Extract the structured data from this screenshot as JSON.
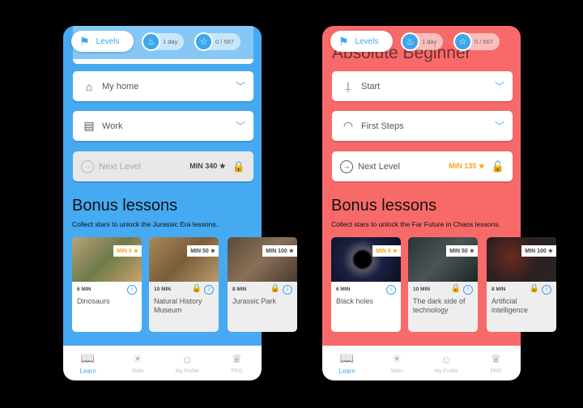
{
  "colors": {
    "accent": "#3ea6ee",
    "gold": "#f5a623"
  },
  "phones": [
    {
      "bg": "#45aaf2",
      "top_title": "",
      "top_chips": {
        "levels": "Levels",
        "streak": "1 day",
        "stars": "0 / 567"
      },
      "rows": [
        {
          "label": "My home",
          "icon": "home-icon",
          "glyph": "⌂"
        },
        {
          "label": "Work",
          "icon": "office-icon",
          "glyph": "▤"
        }
      ],
      "next": {
        "label": "Next Level",
        "min": "MIN 340",
        "locked": true
      },
      "bonus_title": "Bonus lessons",
      "bonus_sub": "Collect stars to unlock the Jurassic Era lessons.",
      "lessons": [
        {
          "badge": "MIN 0",
          "dur": "6 MIN",
          "title": "Dinosaurs",
          "locked": false,
          "img": "linear-gradient(135deg,#b8a27a,#6e7a4a 50%,#c9a46b)"
        },
        {
          "badge": "MIN 50",
          "dur": "10 MIN",
          "title": "Natural History Museum",
          "locked": true,
          "img": "linear-gradient(135deg,#a8885a,#7a5e3a 50%,#b89a6a)"
        },
        {
          "badge": "MIN 100",
          "dur": "8 MIN",
          "title": "Jurassic Park",
          "locked": true,
          "img": "linear-gradient(135deg,#5a4a3a,#8a7058 50%,#4a3a2e)"
        }
      ]
    },
    {
      "bg": "#f86a6a",
      "top_title": "Absolute Beginner",
      "top_chips": {
        "levels": "Levels",
        "streak": "1 day",
        "stars": "0 / 567"
      },
      "rows": [
        {
          "label": "Start",
          "icon": "rocket-launch-icon",
          "glyph": "⍊"
        },
        {
          "label": "First Steps",
          "icon": "speedometer-icon",
          "glyph": "◠"
        }
      ],
      "next": {
        "label": "Next Level",
        "min": "MIN 135",
        "locked": false
      },
      "bonus_title": "Bonus lessons",
      "bonus_sub": "Collect stars to unlock the Far Future in Chaos lessons.",
      "lessons": [
        {
          "badge": "MIN 0",
          "dur": "6 MIN",
          "title": "Black holes",
          "locked": false,
          "img": "radial-gradient(circle at 45% 50%,#000 18%,#556 24%,#1a2040 45%,#0c1020)"
        },
        {
          "badge": "MIN 50",
          "dur": "10 MIN",
          "title": "The dark side of technology",
          "locked": true,
          "img": "linear-gradient(135deg,#2a3434,#4a5454 50%,#1e2626)"
        },
        {
          "badge": "MIN 100",
          "dur": "8 MIN",
          "title": "Artificial intelligence",
          "locked": true,
          "img": "radial-gradient(circle at 35% 45%,#6a2a20,#2e2020 50%,#262626)"
        }
      ]
    }
  ],
  "nav": [
    {
      "label": "Learn",
      "icon": "book-icon",
      "glyph": "📖",
      "active": true
    },
    {
      "label": "Skills",
      "icon": "lightbulb-icon",
      "glyph": "☀",
      "active": false
    },
    {
      "label": "My Profile",
      "icon": "profile-icon",
      "glyph": "☺",
      "active": false
    },
    {
      "label": "PRO",
      "icon": "crown-icon",
      "glyph": "♛",
      "active": false
    }
  ]
}
